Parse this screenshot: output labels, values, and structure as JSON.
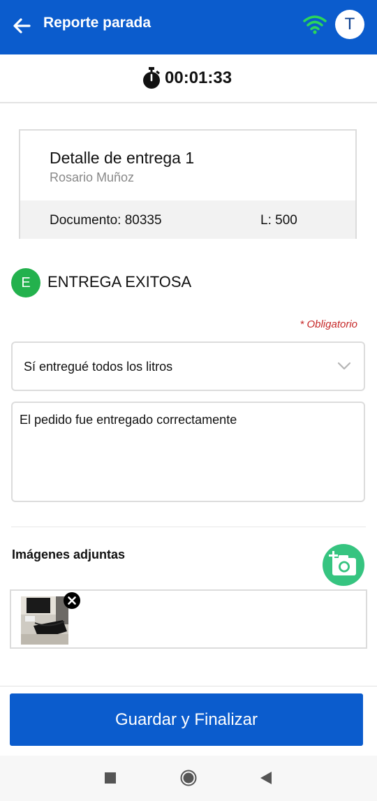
{
  "header": {
    "title": "Reporte parada",
    "avatar_initial": "T",
    "back_icon": "arrow-left-icon",
    "wifi_icon": "wifi-icon",
    "bar_color": "#0b5ccd",
    "wifi_color": "#2bd65a"
  },
  "timer": {
    "icon": "stopwatch-icon",
    "value": "00:01:33"
  },
  "delivery_card": {
    "title": "Detalle de entrega 1",
    "customer": "Rosario Muñoz",
    "document": "Documento: 80335",
    "liters": "L: 500"
  },
  "status": {
    "badge_letter": "E",
    "label": "ENTREGA EXITOSA",
    "color": "#23b14d"
  },
  "form": {
    "required_note": "* Obligatorio",
    "delivery_select_value": "Sí entregué todos los litros",
    "comment_value": "El pedido fue entregado correctamente"
  },
  "attachments": {
    "label": "Imágenes adjuntas",
    "add_icon": "add-photo-icon",
    "remove_icon": "close-icon",
    "count": 1
  },
  "actions": {
    "primary_label": "Guardar y Finalizar",
    "primary_color": "#0b5ccd"
  },
  "system_nav": {
    "recents_icon": "square-icon",
    "home_icon": "circle-icon",
    "back_icon": "triangle-back-icon"
  }
}
